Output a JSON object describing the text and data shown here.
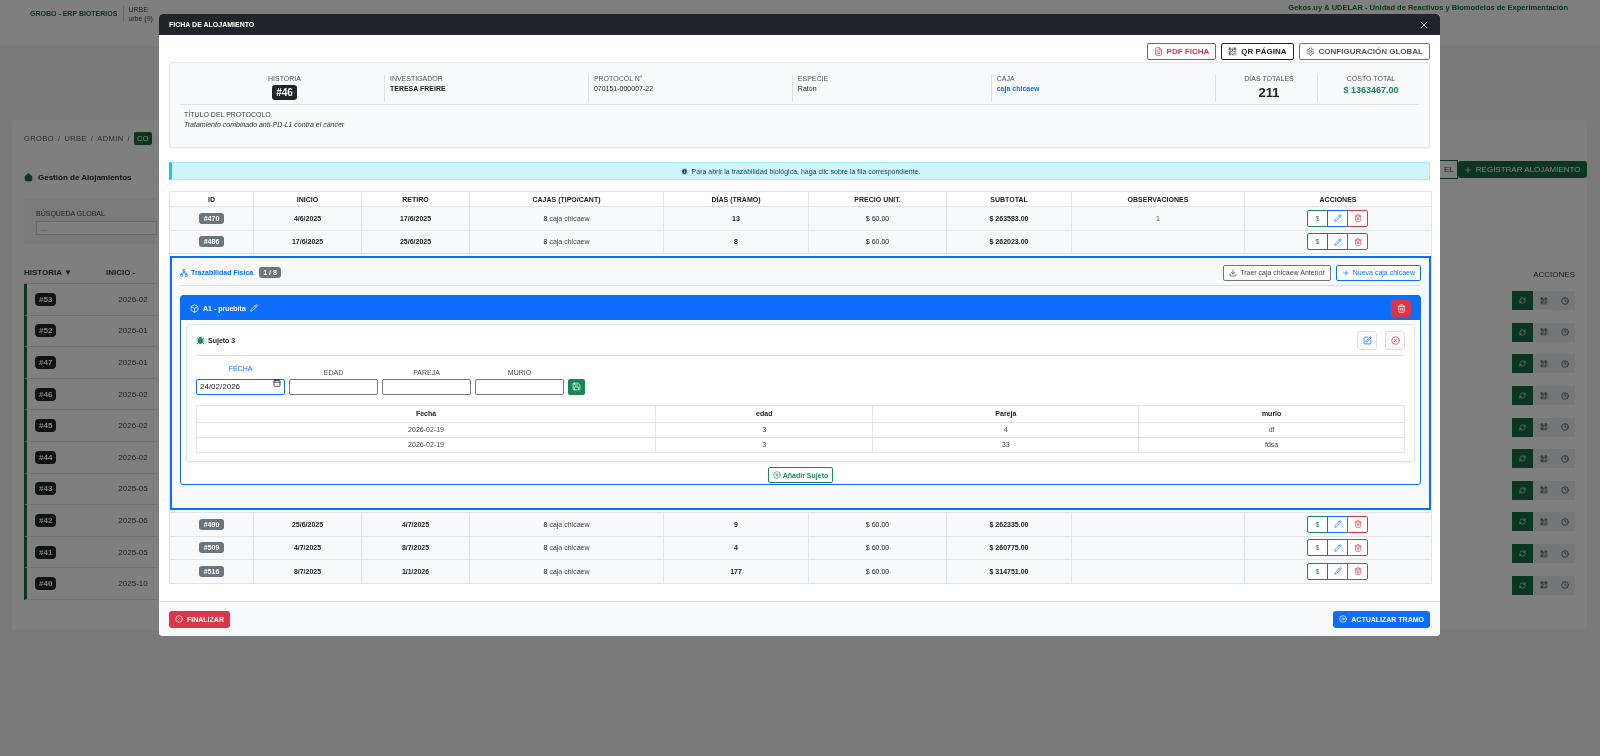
{
  "background": {
    "app_name": "GROBO - ERP BIOTERIOS",
    "instance": "URBE",
    "instance_detail": "urbe (9)",
    "org_link": "Gekos.uy & UDELAR - Unidad de Reactivos y Biomodelos de Experimentación",
    "breadcrumbs": [
      {
        "label": "GROBO",
        "kind": "link"
      },
      {
        "label": "/",
        "kind": "separator"
      },
      {
        "label": "URBE",
        "kind": "link"
      },
      {
        "label": "/",
        "kind": "separator"
      },
      {
        "label": "ADMIN",
        "kind": "link"
      },
      {
        "label": "/",
        "kind": "separator"
      },
      {
        "label": "CO",
        "kind": "current"
      }
    ],
    "page_title": "Gestión de Alojamientos",
    "search": {
      "label": "BÚSQUEDA GLOBAL",
      "placeholder": "..."
    },
    "export_button": "EL",
    "register_button": "REGISTRAR ALOJAMIENTO",
    "columns": [
      "HISTORIA ▼",
      "INICIO -"
    ],
    "actions_column": "ACCIONES",
    "rows": [
      {
        "id": "#53",
        "date": "2026-02"
      },
      {
        "id": "#52",
        "date": "2026-01"
      },
      {
        "id": "#47",
        "date": "2026-01"
      },
      {
        "id": "#46",
        "date": "2026-02"
      },
      {
        "id": "#45",
        "date": "2026-02"
      },
      {
        "id": "#44",
        "date": "2026-02"
      },
      {
        "id": "#43",
        "date": "2025-05"
      },
      {
        "id": "#42",
        "date": "2025-06"
      },
      {
        "id": "#41",
        "date": "2025-05"
      },
      {
        "id": "#40",
        "date": "2025-10"
      }
    ]
  },
  "modal": {
    "title": "FICHA DE ALOJAMIENTO",
    "toolbar": [
      {
        "label": "PDF FICHA",
        "kind": "pdf"
      },
      {
        "label": "QR PÁGINA",
        "kind": "qr"
      },
      {
        "label": "CONFIGURACIÓN GLOBAL",
        "kind": "settings"
      }
    ],
    "summary": [
      {
        "label": "HISTORIA",
        "value": "#46",
        "kind": "badge"
      },
      {
        "label": "INVESTIGADOR",
        "value": "TERESA FREIRE",
        "kind": "strong"
      },
      {
        "label": "PROTOCOL N°",
        "value": "070151-000007-22",
        "kind": "text"
      },
      {
        "label": "ESPECIE",
        "value": "Raton",
        "kind": "text"
      },
      {
        "label": "CAJA",
        "value": "caja chicaew",
        "kind": "link"
      },
      {
        "label": "DÍAS TOTALES",
        "value": "211",
        "kind": "stat"
      },
      {
        "label": "COSTO TOTAL",
        "value": "$ 1363467.00",
        "kind": "money"
      }
    ],
    "protocol_title": {
      "label": "TÍTULO DEL PROTOCOLO",
      "value": "Tratamiento combinado anti-PD-L1 contra el cáncer"
    },
    "notice": "Para abrir la trazabilidad biológica, haga clic sobre la fila correspondiente.",
    "columns": [
      "ID",
      "INICIO",
      "RETIRO",
      "CAJAS (TIPO/CANT)",
      "DÍAS (TRAMO)",
      "PRECIO UNIT.",
      "SUBTOTAL",
      "OBSERVACIONES",
      "ACCIONES"
    ],
    "rows": [
      {
        "id": "#470",
        "inicio": "4/6/2025",
        "retiro": "17/6/2025",
        "count": "8",
        "box": "caja chicaew",
        "dias": "13",
        "precio": "$ 60.00",
        "subtotal": "$ 263583.00",
        "obs": "1",
        "price_action": "$"
      },
      {
        "id": "#486",
        "inicio": "17/6/2025",
        "retiro": "25/6/2025",
        "count": "8",
        "box": "caja chicaew",
        "dias": "8",
        "precio": "$ 60.00",
        "subtotal": "$ 262023.00",
        "price_action": "$",
        "trace": {
          "title": "Trazabilidad Física",
          "counter": "1 / 8",
          "buttons": [
            {
              "label": "Traer caja chicaew Anterior",
              "kind": "import"
            },
            {
              "label": "Nueva caja chicaew",
              "kind": "new"
            }
          ],
          "boxes": [
            {
              "name": "A1 - pruebita",
              "subjects": [
                {
                  "name": "Sujeto 3",
                  "fields": [
                    {
                      "label": "FECHA",
                      "kind": "date",
                      "value": "24/02/2026",
                      "selected": true
                    },
                    {
                      "label": "EDAD",
                      "kind": "text",
                      "selected": false
                    },
                    {
                      "label": "PAREJA",
                      "kind": "text",
                      "selected": false
                    },
                    {
                      "label": "MURIO",
                      "kind": "text",
                      "selected": false
                    }
                  ],
                  "columns": [
                    "Fecha",
                    "edad",
                    "Pareja",
                    "murio"
                  ],
                  "rows": [
                    [
                      "2026-02-19",
                      "3",
                      "4",
                      "df"
                    ],
                    [
                      "2026-02-19",
                      "3",
                      "33",
                      "fdsa"
                    ]
                  ]
                }
              ],
              "add_subject": "Añadir Sujeto"
            }
          ]
        }
      },
      {
        "id": "#490",
        "inicio": "25/6/2025",
        "retiro": "4/7/2025",
        "count": "8",
        "box": "caja chicaew",
        "dias": "9",
        "precio": "$ 60.00",
        "subtotal": "$ 262335.00",
        "price_action": "$"
      },
      {
        "id": "#509",
        "inicio": "4/7/2025",
        "retiro": "8/7/2025",
        "count": "8",
        "box": "caja chicaew",
        "dias": "4",
        "precio": "$ 60.00",
        "subtotal": "$ 260775.00",
        "price_action": "$"
      },
      {
        "id": "#516",
        "inicio": "8/7/2025",
        "retiro": "1/1/2026",
        "count": "8",
        "box": "caja chicaew",
        "dias": "177",
        "precio": "$ 60.00",
        "subtotal": "$ 314751.00",
        "price_action": "$"
      }
    ],
    "footer": [
      {
        "label": "FINALIZAR",
        "kind": "finish"
      },
      {
        "label": "ACTUALIZAR TRAMO",
        "kind": "update"
      }
    ]
  }
}
